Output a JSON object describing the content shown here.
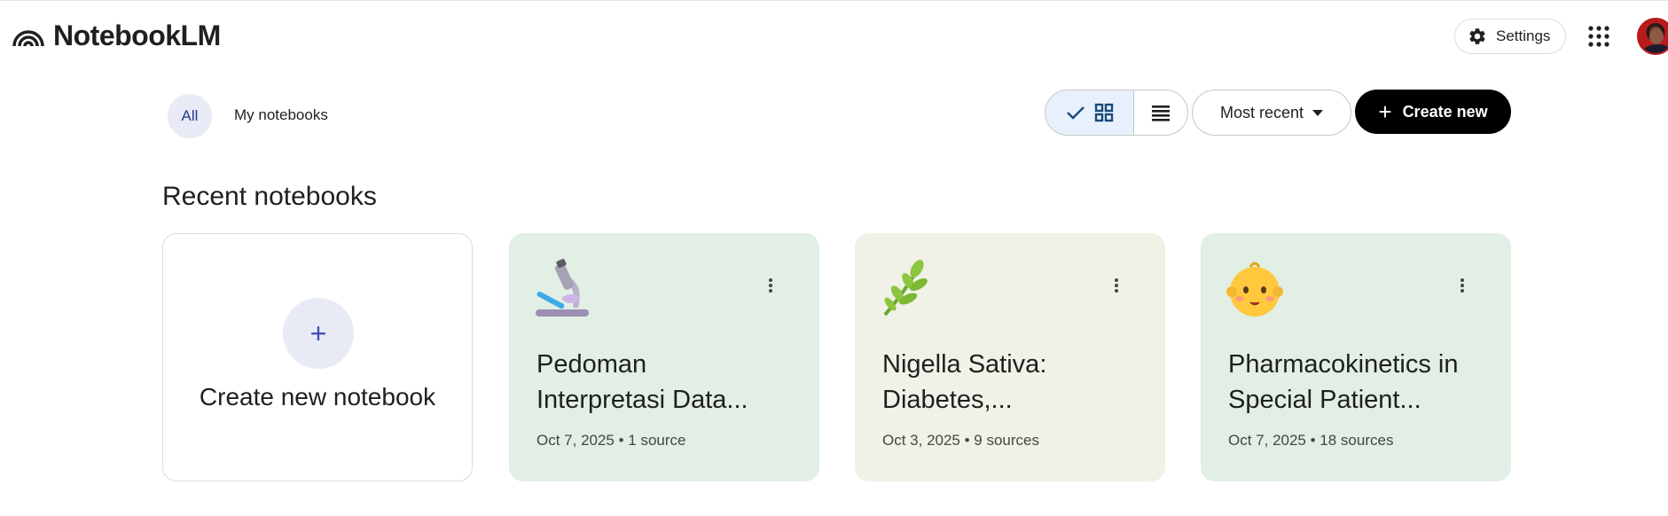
{
  "app": {
    "name": "NotebookLM"
  },
  "header": {
    "settings_label": "Settings"
  },
  "filters": {
    "all_label": "All",
    "my_label": "My notebooks"
  },
  "toolbar": {
    "sort_label": "Most recent",
    "create_label": "Create new"
  },
  "section": {
    "title": "Recent notebooks"
  },
  "create_card": {
    "label": "Create new notebook",
    "icon": "plus-icon"
  },
  "notebooks": [
    {
      "title_line1": "Pedoman",
      "title_line2": "Interpretasi Data...",
      "meta": "Oct 7, 2025 • 1 source",
      "emoji": "microscope",
      "bg": "#e1efe4"
    },
    {
      "title_line1": "Nigella Sativa:",
      "title_line2": "Diabetes,...",
      "meta": "Oct 3, 2025 • 9 sources",
      "emoji": "herb",
      "bg": "#f1f1e7"
    },
    {
      "title_line1": "Pharmacokinetics in",
      "title_line2": "Special Patient...",
      "meta": "Oct 7, 2025 • 18 sources",
      "emoji": "baby",
      "bg": "#e1efe4"
    }
  ],
  "colors": {
    "primary_button": "#000000",
    "accent": "#3f51b5",
    "selected_tab": "#e8eaf6"
  }
}
